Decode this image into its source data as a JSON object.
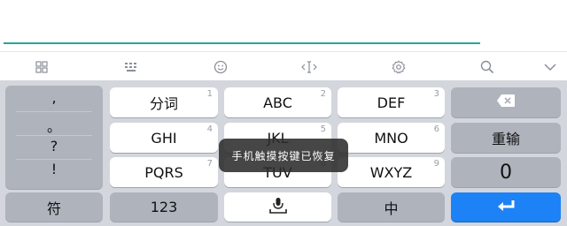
{
  "toolbar": {
    "icons": [
      "grid-icon",
      "keyboard-icon",
      "emoji-icon",
      "cursor-icon",
      "settings-icon",
      "search-icon",
      "chevron-down-icon"
    ]
  },
  "keyboard": {
    "punctuation": [
      ",",
      "。",
      "?",
      "!"
    ],
    "row1": [
      {
        "label": "分词",
        "num": "1"
      },
      {
        "label": "ABC",
        "num": "2"
      },
      {
        "label": "DEF",
        "num": "3"
      }
    ],
    "row2": [
      {
        "label": "GHI",
        "num": "4"
      },
      {
        "label": "JKL",
        "num": "5"
      },
      {
        "label": "MNO",
        "num": "6"
      }
    ],
    "row3": [
      {
        "label": "PQRS",
        "num": "7"
      },
      {
        "label": "TUV",
        "num": "8"
      },
      {
        "label": "WXYZ",
        "num": "9"
      }
    ],
    "reenter_label": "重输",
    "zero_label": "0",
    "symbols_label": "符",
    "numbers_label": "123",
    "lang_label": "中"
  },
  "toast": "手机触摸按键已恢复",
  "colors": {
    "accent": "#26a69a",
    "enter": "#1d82f5",
    "keyboard_bg": "#d3d6dc"
  }
}
